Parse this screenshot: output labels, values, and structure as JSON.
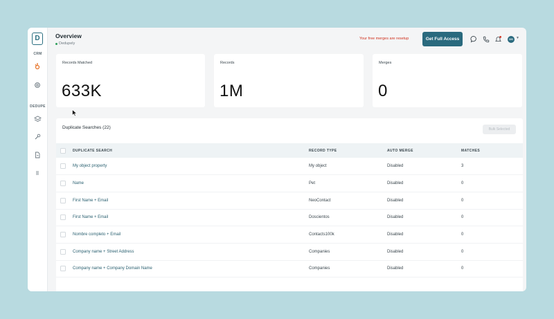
{
  "sidebar": {
    "logo": "D",
    "crm_label": "CRM",
    "dedupe_label": "DEDUPE"
  },
  "header": {
    "title": "Overview",
    "subtitle": "Dedupely",
    "notice": "Your free merges are resetup",
    "cta": "Get Full Access",
    "avatar": "DS"
  },
  "cards": [
    {
      "label": "Records Matched",
      "value": "633K"
    },
    {
      "label": "Records",
      "value": "1M"
    },
    {
      "label": "Merges",
      "value": "0"
    }
  ],
  "panel": {
    "title": "Duplicate Searches (22)",
    "bulk_button": "Bulk Selected",
    "columns": [
      "DUPLICATE SEARCH",
      "RECORD TYPE",
      "AUTO MERGE",
      "MATCHES"
    ],
    "rows": [
      {
        "name": "My object property",
        "type": "My object",
        "auto": "Disabled",
        "matches": "3"
      },
      {
        "name": "Name",
        "type": "Pet",
        "auto": "Disabled",
        "matches": "0"
      },
      {
        "name": "First Name + Email",
        "type": "NeoContact",
        "auto": "Disabled",
        "matches": "0"
      },
      {
        "name": "First Name + Email",
        "type": "Doscientos",
        "auto": "Disabled",
        "matches": "0"
      },
      {
        "name": "Nombre completo + Email",
        "type": "Contacts100k",
        "auto": "Disabled",
        "matches": "0"
      },
      {
        "name": "Company name + Street Address",
        "type": "Companies",
        "auto": "Disabled",
        "matches": "0"
      },
      {
        "name": "Company name + Company Domain Name",
        "type": "Companies",
        "auto": "Disabled",
        "matches": "0"
      }
    ]
  },
  "colors": {
    "accent": "#2a6a7e",
    "notice": "#d0321f",
    "crm_icon": "#e8772e",
    "background": "#b8dae0"
  },
  "icons": [
    "logo-icon",
    "hubspot-icon",
    "settings-icon",
    "layers-icon",
    "tools-icon",
    "document-icon",
    "list-icon",
    "chat-icon",
    "phone-icon",
    "bell-icon"
  ]
}
